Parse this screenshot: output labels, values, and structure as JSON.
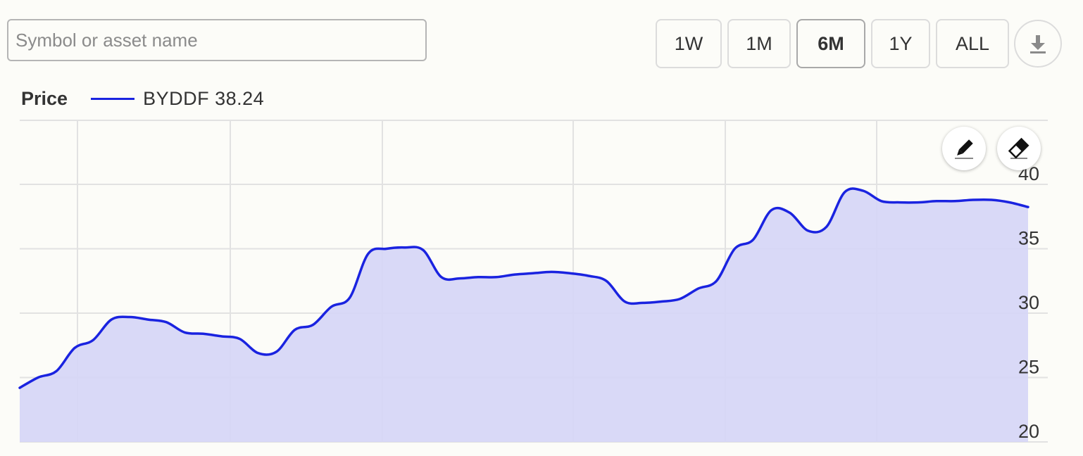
{
  "search": {
    "placeholder": "Symbol or asset name",
    "value": ""
  },
  "ranges": [
    {
      "label": "1W",
      "active": false
    },
    {
      "label": "1M",
      "active": false
    },
    {
      "label": "6M",
      "active": true
    },
    {
      "label": "1Y",
      "active": false
    },
    {
      "label": "ALL",
      "active": false
    }
  ],
  "download": {
    "icon": "download-icon"
  },
  "legend": {
    "title": "Price",
    "series_label": "BYDDF 38.24"
  },
  "tools": {
    "draw_icon": "pencil-icon",
    "erase_icon": "eraser-icon"
  },
  "colors": {
    "line": "#1a23e0",
    "fill": "#d6d6f6",
    "grid": "#e2e2e2"
  },
  "chart_data": {
    "type": "area",
    "title": "Price",
    "y_ticks": [
      20,
      25,
      30,
      35,
      40
    ],
    "ylim": [
      20,
      42.5
    ],
    "grid": true,
    "legend_position": "top-left",
    "series": [
      {
        "name": "BYDDF",
        "last_value": 38.24,
        "values": [
          24.2,
          25.0,
          25.5,
          27.3,
          27.9,
          29.5,
          29.7,
          29.5,
          29.3,
          28.5,
          28.4,
          28.2,
          28.0,
          26.9,
          27.0,
          28.7,
          29.1,
          30.5,
          31.2,
          34.6,
          35.0,
          35.1,
          34.9,
          32.8,
          32.7,
          32.8,
          32.8,
          33.0,
          33.1,
          33.2,
          33.1,
          32.9,
          32.5,
          30.9,
          30.8,
          30.9,
          31.1,
          31.9,
          32.5,
          35.0,
          35.7,
          38.0,
          37.8,
          36.4,
          36.7,
          39.4,
          39.5,
          38.7,
          38.6,
          38.6,
          38.7,
          38.7,
          38.8,
          38.8,
          38.6,
          38.24
        ]
      }
    ]
  }
}
